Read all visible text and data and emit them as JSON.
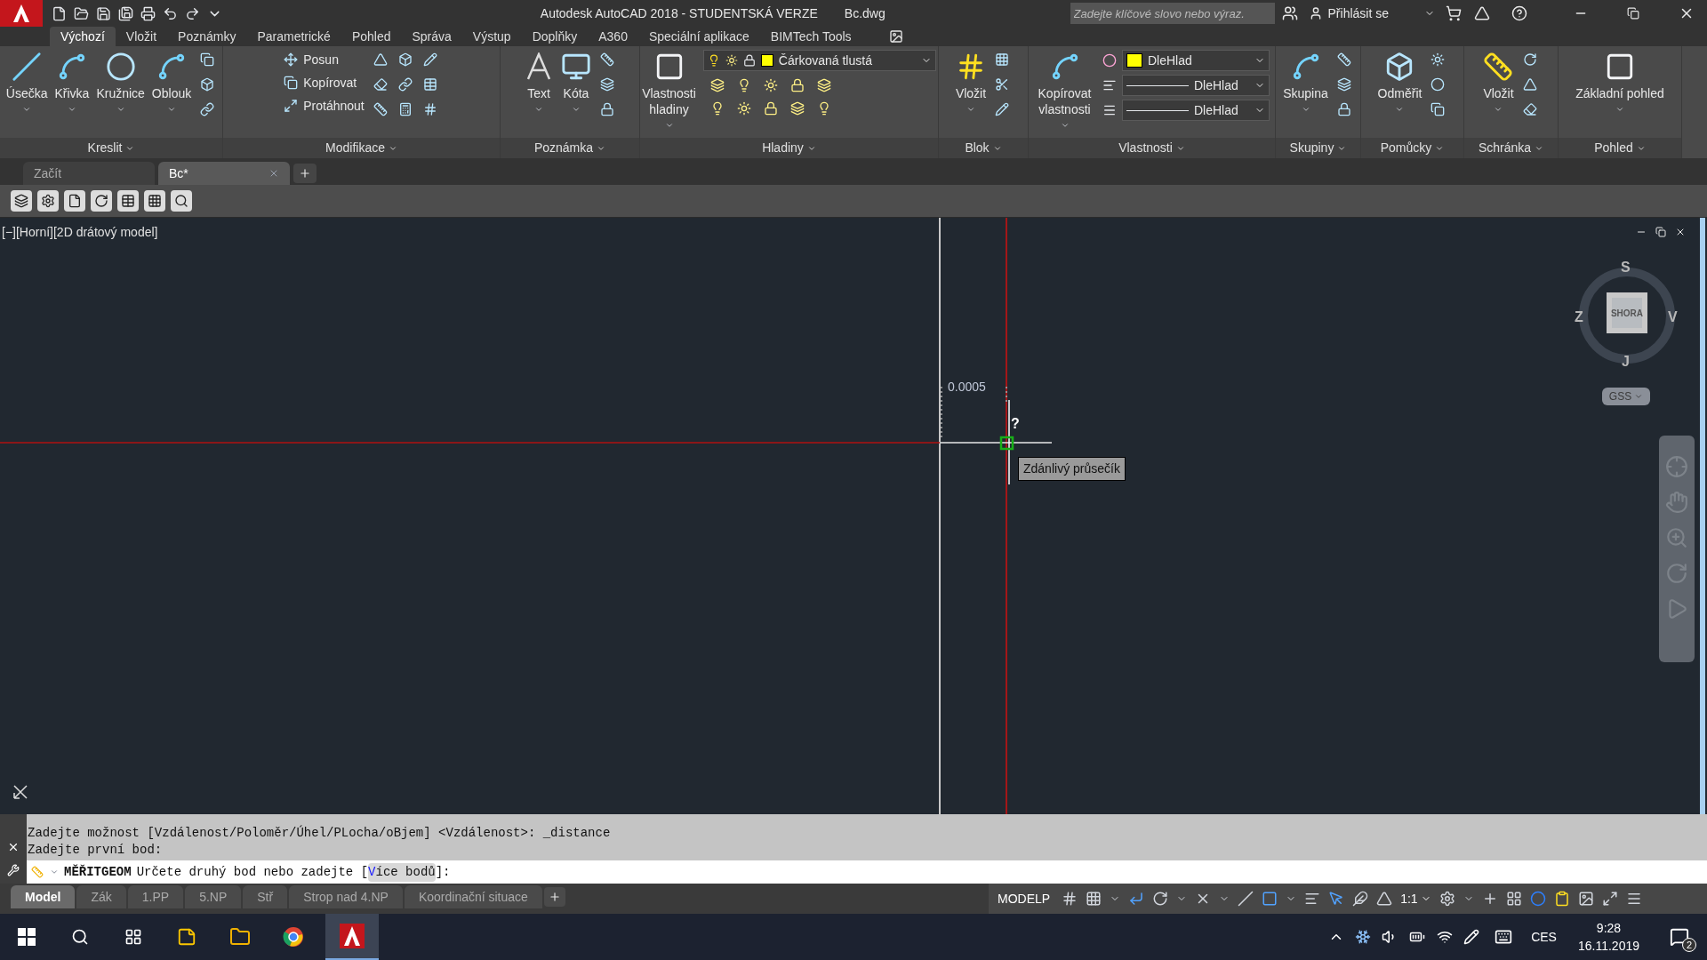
{
  "title_bar": {
    "title": "Autodesk AutoCAD 2018 - STUDENTSKÁ VERZE",
    "file": "Bc.dwg",
    "search_placeholder": "Zadejte klíčové slovo nebo výraz.",
    "sign_in": "Přihlásit se"
  },
  "ribbon_tabs": [
    {
      "label": "Výchozí",
      "selected": true
    },
    {
      "label": "Vložit",
      "selected": false
    },
    {
      "label": "Poznámky",
      "selected": false
    },
    {
      "label": "Parametrické",
      "selected": false
    },
    {
      "label": "Pohled",
      "selected": false
    },
    {
      "label": "Správa",
      "selected": false
    },
    {
      "label": "Výstup",
      "selected": false
    },
    {
      "label": "Doplňky",
      "selected": false
    },
    {
      "label": "A360",
      "selected": false
    },
    {
      "label": "Speciální aplikace",
      "selected": false
    },
    {
      "label": "BIMTech Tools",
      "selected": false
    }
  ],
  "ribbon_panels": [
    {
      "title": "Kreslit",
      "items": [
        {
          "kind": "large",
          "label": "Úsečka"
        },
        {
          "kind": "large",
          "label": "Křivka"
        },
        {
          "kind": "large",
          "label": "Kružnice"
        },
        {
          "kind": "large",
          "label": "Oblouk"
        },
        {
          "kind": "icon_column"
        }
      ]
    },
    {
      "title": "Modifikace",
      "items": [
        {
          "kind": "small_stack",
          "labels": [
            "Posun",
            "Kopírovat",
            "Protáhnout"
          ]
        },
        {
          "kind": "icon_column"
        },
        {
          "kind": "icon_column"
        },
        {
          "kind": "icon_column"
        }
      ]
    },
    {
      "title": "Poznámka",
      "items": [
        {
          "kind": "large",
          "label": "Text"
        },
        {
          "kind": "large",
          "label": "Kóta"
        },
        {
          "kind": "icon_column"
        }
      ]
    },
    {
      "title": "Hladiny",
      "items": [
        {
          "kind": "large",
          "label": "Vlastnosti hladiny"
        },
        {
          "kind": "layer_select",
          "value": "Čárkovaná tlustá",
          "color": "#ffff00"
        }
      ]
    },
    {
      "title": "Blok",
      "items": [
        {
          "kind": "large",
          "label": "Vložit"
        },
        {
          "kind": "icon_column"
        }
      ]
    },
    {
      "title": "Vlastnosti",
      "items": [
        {
          "kind": "large",
          "label": "Kopírovat vlastnosti"
        },
        {
          "kind": "select_stack",
          "selects": [
            {
              "kind": "color",
              "value": "DleHlad",
              "color": "#ffff00"
            },
            {
              "kind": "linetype",
              "value": "DleHlad"
            },
            {
              "kind": "lineweight",
              "value": "DleHlad"
            }
          ]
        }
      ]
    },
    {
      "title": "Skupiny",
      "items": [
        {
          "kind": "large",
          "label": "Skupina"
        },
        {
          "kind": "icon_column"
        }
      ]
    },
    {
      "title": "Pomůcky",
      "items": [
        {
          "kind": "large",
          "label": "Odměřit"
        },
        {
          "kind": "icon_column"
        }
      ]
    },
    {
      "title": "Schránka",
      "items": [
        {
          "kind": "large",
          "label": "Vložit"
        },
        {
          "kind": "icon_column"
        }
      ]
    },
    {
      "title": "Pohled",
      "items": [
        {
          "kind": "large",
          "label": "Základní pohled"
        }
      ]
    }
  ],
  "file_tabs": [
    {
      "label": "Začít",
      "selected": false
    },
    {
      "label": "Bc*",
      "selected": true
    }
  ],
  "viewport": {
    "label": "[−][Horní][2D drátový model]",
    "dimension": "0.0005",
    "snap_marker": "?",
    "tooltip": "Zdánlivý průsečík",
    "viewcube": {
      "north": "S",
      "east": "V",
      "south": "J",
      "west": "Z",
      "face": "SHORA",
      "ucs": "GSS"
    }
  },
  "command_line": {
    "history": [
      "Zadejte možnost [Vzdálenost/Poloměr/Úhel/PLocha/oBjem] <Vzdálenost>: _distance",
      "Zadejte první bod:"
    ],
    "command": "MĚŘITGEOM",
    "prompt": "Určete druhý bod nebo zadejte [",
    "option_hotkey": "V",
    "option_rest": "íce bodů",
    "prompt_end": "]:"
  },
  "layout_tabs": [
    {
      "label": "Model",
      "selected": true
    },
    {
      "label": "Zák",
      "selected": false
    },
    {
      "label": "1.PP",
      "selected": false
    },
    {
      "label": "5.NP",
      "selected": false
    },
    {
      "label": "Stř",
      "selected": false
    },
    {
      "label": "Strop nad 4.NP",
      "selected": false
    },
    {
      "label": "Koordinační situace",
      "selected": false
    }
  ],
  "status_bar": {
    "space": "MODELP",
    "scale": "1:1"
  },
  "taskbar": {
    "language": "CES",
    "time": "9:28",
    "date": "16.11.2019",
    "notifications": "2"
  }
}
